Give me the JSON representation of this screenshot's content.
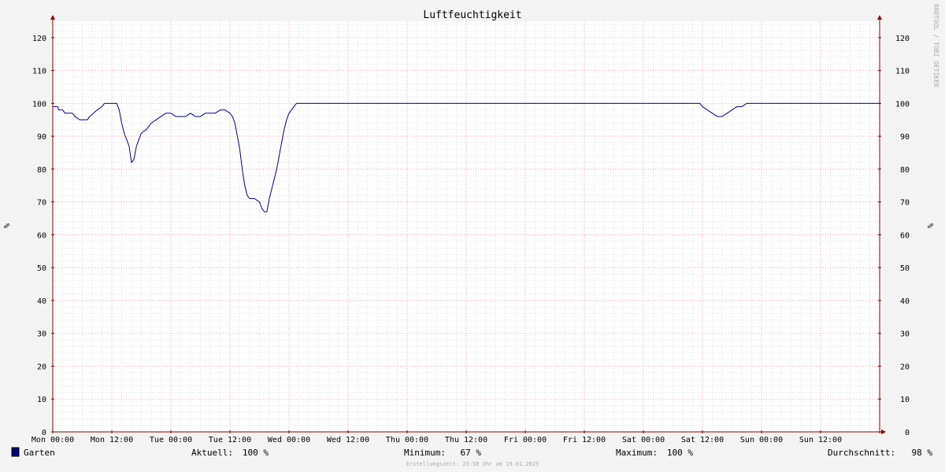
{
  "chart_data": {
    "type": "line",
    "title": "Luftfeuchtigkeit",
    "ylabel": "%",
    "ylim": [
      0,
      125
    ],
    "yticks": [
      0,
      10,
      20,
      30,
      40,
      50,
      60,
      70,
      80,
      90,
      100,
      110,
      120
    ],
    "xlim": [
      0,
      168
    ],
    "x_unit": "hours since Mon 00:00",
    "xticks": [
      {
        "x": 0,
        "label": "Mon 00:00"
      },
      {
        "x": 12,
        "label": "Mon 12:00"
      },
      {
        "x": 24,
        "label": "Tue 00:00"
      },
      {
        "x": 36,
        "label": "Tue 12:00"
      },
      {
        "x": 48,
        "label": "Wed 00:00"
      },
      {
        "x": 60,
        "label": "Wed 12:00"
      },
      {
        "x": 72,
        "label": "Thu 00:00"
      },
      {
        "x": 84,
        "label": "Thu 12:00"
      },
      {
        "x": 96,
        "label": "Fri 00:00"
      },
      {
        "x": 108,
        "label": "Fri 12:00"
      },
      {
        "x": 120,
        "label": "Sat 00:00"
      },
      {
        "x": 132,
        "label": "Sat 12:00"
      },
      {
        "x": 144,
        "label": "Sun 00:00"
      },
      {
        "x": 156,
        "label": "Sun 12:00"
      }
    ],
    "grid": true,
    "series": [
      {
        "name": "Garten",
        "color": "#000080",
        "points": [
          [
            0,
            99
          ],
          [
            1,
            99
          ],
          [
            1.2,
            98
          ],
          [
            2,
            98
          ],
          [
            2.5,
            97
          ],
          [
            4,
            97
          ],
          [
            4.5,
            96
          ],
          [
            5.5,
            95
          ],
          [
            7,
            95
          ],
          [
            7.5,
            96
          ],
          [
            9,
            98
          ],
          [
            10,
            99
          ],
          [
            10.5,
            100
          ],
          [
            13,
            100
          ],
          [
            13.5,
            98
          ],
          [
            14,
            94
          ],
          [
            14.5,
            91
          ],
          [
            15,
            89
          ],
          [
            15.5,
            87
          ],
          [
            16,
            82
          ],
          [
            16.5,
            83
          ],
          [
            17,
            87
          ],
          [
            17.5,
            89
          ],
          [
            18,
            91
          ],
          [
            19,
            92
          ],
          [
            20,
            94
          ],
          [
            21,
            95
          ],
          [
            22,
            96
          ],
          [
            23,
            97
          ],
          [
            24,
            97
          ],
          [
            25,
            96
          ],
          [
            26,
            96
          ],
          [
            27,
            96
          ],
          [
            28,
            97
          ],
          [
            29,
            96
          ],
          [
            30,
            96
          ],
          [
            31,
            97
          ],
          [
            32,
            97
          ],
          [
            33,
            97
          ],
          [
            34,
            98
          ],
          [
            35,
            98
          ],
          [
            36,
            97
          ],
          [
            36.5,
            96
          ],
          [
            37,
            94
          ],
          [
            37.5,
            90
          ],
          [
            38,
            86
          ],
          [
            38.5,
            80
          ],
          [
            39,
            75
          ],
          [
            39.5,
            72
          ],
          [
            40,
            71
          ],
          [
            41,
            71
          ],
          [
            42,
            70
          ],
          [
            42.5,
            68
          ],
          [
            43,
            67
          ],
          [
            43.5,
            67
          ],
          [
            44,
            71
          ],
          [
            44.5,
            74
          ],
          [
            45,
            77
          ],
          [
            45.5,
            80
          ],
          [
            46,
            84
          ],
          [
            46.5,
            88
          ],
          [
            47,
            92
          ],
          [
            47.5,
            95
          ],
          [
            48,
            97
          ],
          [
            48.5,
            98
          ],
          [
            49,
            99
          ],
          [
            49.5,
            100
          ],
          [
            131.5,
            100
          ],
          [
            132,
            99
          ],
          [
            133,
            98
          ],
          [
            134,
            97
          ],
          [
            135,
            96
          ],
          [
            136,
            96
          ],
          [
            137,
            97
          ],
          [
            138,
            98
          ],
          [
            139,
            99
          ],
          [
            140,
            99
          ],
          [
            141,
            100
          ],
          [
            168,
            100
          ]
        ]
      }
    ],
    "legend": {
      "series_label": "Garten",
      "current_label": "Aktuell:",
      "current_value": "100 %",
      "min_label": "Minimum:",
      "min_value": " 67 %",
      "max_label": "Maximum:",
      "max_value": "100 %",
      "avg_label": "Durchschnitt:",
      "avg_value": " 98 %"
    },
    "footer": "Erstellungszeit: 23:58 Uhr am 19.01.2025",
    "watermark": "RRDTOOL / TOBI OETIKER",
    "colors": {
      "background": "#f3f3f3",
      "canvas": "#ffffff",
      "minor_grid": "#d0d0d0",
      "major_grid": "#ee9999",
      "axis": "#8b0000",
      "line": "#000080"
    }
  }
}
